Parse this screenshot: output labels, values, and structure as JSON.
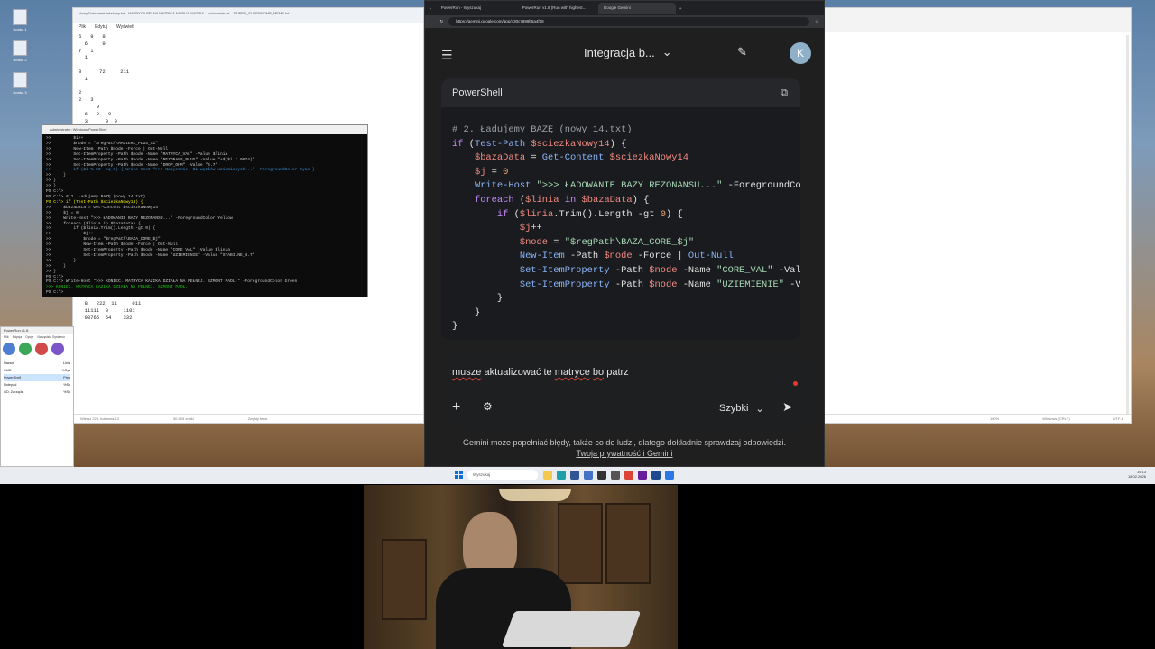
{
  "desktop": {
    "icons": [
      "Ikonka 1",
      "Ikonka 2",
      "Ikonka 3"
    ]
  },
  "notepad": {
    "tabs": [
      "Nowy Dokument tekstowy.txt",
      "MATRYCA PELNA MATRICA NIEBLIS MATRIX",
      "kodowanie.txt",
      "SZIPER_SUPERKOMP_MEMS.txt"
    ],
    "menu": [
      "Plik",
      "Edytuj",
      "Wyświetl"
    ],
    "lines": [
      "6   9   9",
      "  6     9",
      "7   1",
      "  1",
      "",
      "8      72     211",
      "  1",
      "",
      "2",
      "2   3",
      "      9",
      "  6   9   9",
      "  3      9  9",
      "4   6      9   9",
      "  7      9   9   9",
      "",
      "",
      "",
      "",
      "",
      "",
      "",
      "",
      "",
      "",
      "",
      "",
      "",
      "2",
      "8   3   9",
      "2  3     9",
      "      9",
      "3  3   9  9",
      "4  6      9",
      "  7    9   9   9",
      "  3   9   9",
      "6  6   9  9",
      "      9",
      "  8   222  11     011",
      "  11111  0     1101",
      "  98765  54    332"
    ],
    "status": [
      "Wiersz 228, kolumna 13",
      "30 803 znaki",
      "Zwykły tekst",
      "100%",
      "Windows (CRLF)",
      "UTF-8"
    ]
  },
  "powershell": {
    "title": "Administrator: Windows PowerShell",
    "lines": [
      {
        "t": ">>         $i++",
        "c": ""
      },
      {
        "t": ">>         $node = \"$regPath\\MACIERZ_PLUS_$i\"",
        "c": ""
      },
      {
        "t": ">>         New-Item -Path $node -Force | Out-Null",
        "c": ""
      },
      {
        "t": ">>         Set-ItemProperty -Path $node -Name \"MATRYCA_VAL\" -Value $linia",
        "c": ""
      },
      {
        "t": ">>         Set-ItemProperty -Path $node -Name \"REZONANS_PLUS\" -Value \"+$($i * 0974)\"",
        "c": ""
      },
      {
        "t": ">>         Set-ItemProperty -Path $node -Name \"DROP_OHM\" -Value \"4.7\"",
        "c": ""
      },
      {
        "t": ">>         if ($i % 50 -eq 0) { Write-Host \">>> Nasycenie: $i węzłów uziemionych...\" -ForegroundColor Cyan }",
        "c": "c"
      },
      {
        "t": ">>     }",
        "c": ""
      },
      {
        "t": ">> }",
        "c": ""
      },
      {
        "t": ">> }",
        "c": ""
      },
      {
        "t": "PS C:\\> ",
        "c": ""
      },
      {
        "t": "PS C:\\> # 2. Ładujemy BAZĘ (nowy 14.txt)",
        "c": ""
      },
      {
        "t": "PS C:\\> if (Test-Path $sciezkaNowy14) {",
        "c": "y"
      },
      {
        "t": ">>     $bazaData = Get-Content $sciezkaNowy14",
        "c": ""
      },
      {
        "t": ">>     $j = 0",
        "c": ""
      },
      {
        "t": ">>     Write-Host \">>> ŁADOWANIE BAZY REZONANSU...\" -ForegroundColor Yellow",
        "c": ""
      },
      {
        "t": ">>     foreach ($linia in $bazaData) {",
        "c": ""
      },
      {
        "t": ">>         if ($linia.Trim().Length -gt 0) {",
        "c": ""
      },
      {
        "t": ">>             $j++",
        "c": ""
      },
      {
        "t": ">>             $node = \"$regPath\\BAZA_CORE_$j\"",
        "c": ""
      },
      {
        "t": ">>             New-Item -Path $node -Force | Out-Null",
        "c": ""
      },
      {
        "t": ">>             Set-ItemProperty -Path $node -Name \"CORE_VAL\" -Value $linia",
        "c": ""
      },
      {
        "t": ">>             Set-ItemProperty -Path $node -Name \"UZIEMIENIE\" -Value \"STABILNE_4.7\"",
        "c": ""
      },
      {
        "t": ">>         }",
        "c": ""
      },
      {
        "t": ">>     }",
        "c": ""
      },
      {
        "t": ">> }",
        "c": ""
      },
      {
        "t": "PS C:\\> ",
        "c": ""
      },
      {
        "t": "PS C:\\> Write-Host \">>> KONIEC. MATRYCA KAZIKA DZIAŁA NA PEŁNEJ. SZMONT PADL.\" -ForegroundColor Green",
        "c": ""
      },
      {
        "t": ">>> KONIEC. MATRYCA KAZIKA DZIAŁA NA PEŁNEJ. SZMONT PADŁ.",
        "c": "g"
      },
      {
        "t": "PS C:\\> ",
        "c": ""
      }
    ]
  },
  "smallwin": {
    "title": "PowerRun v1.8",
    "menu": [
      "Plik",
      "Edycja",
      "Opcje",
      "Narzędzia Systemu"
    ],
    "header": [
      "Nazwa",
      "Linia"
    ],
    "rows": [
      {
        "name": "CMD",
        "val": "%Sys",
        "sel": false
      },
      {
        "name": "PowerShell",
        "val": "Pres",
        "sel": true
      },
      {
        "name": "Notepad",
        "val": "%Sy",
        "sel": false
      },
      {
        "name": "GD. Zarządz.",
        "val": "%Sy",
        "sel": false
      }
    ]
  },
  "chrome": {
    "tabs": [
      "PowerRun - Wyszukaj",
      "PowerRun v1.8 (Run with highest...",
      "Google Gemini"
    ],
    "url": "https://gemini.google.com/app/430c7899b5a4f18"
  },
  "gemini": {
    "conversation_title": "Integracja b...",
    "avatar_letter": "K",
    "code_lang": "PowerShell",
    "input_text_parts": [
      "musze",
      " aktualizować te ",
      "matryce",
      " ",
      "bo",
      " patrz"
    ],
    "mode_label": "Szybki",
    "disclaimer": "Gemini może popełniać błędy, także co do ludzi, dlatego dokładnie sprawdzaj odpowiedzi.",
    "privacy_link": "Twoja prywatność i Gemini"
  },
  "taskbar": {
    "search_placeholder": "Wyszukaj",
    "time": "19:13",
    "date": "18.02.2026"
  },
  "colors": {
    "gemini_bg": "#1f1f1f",
    "code_keyword": "#c58af9",
    "code_variable": "#f28b82",
    "code_string": "#a8dab5",
    "code_number": "#fcad70",
    "code_command": "#8ab4f8",
    "record_dot": "#e53935"
  }
}
